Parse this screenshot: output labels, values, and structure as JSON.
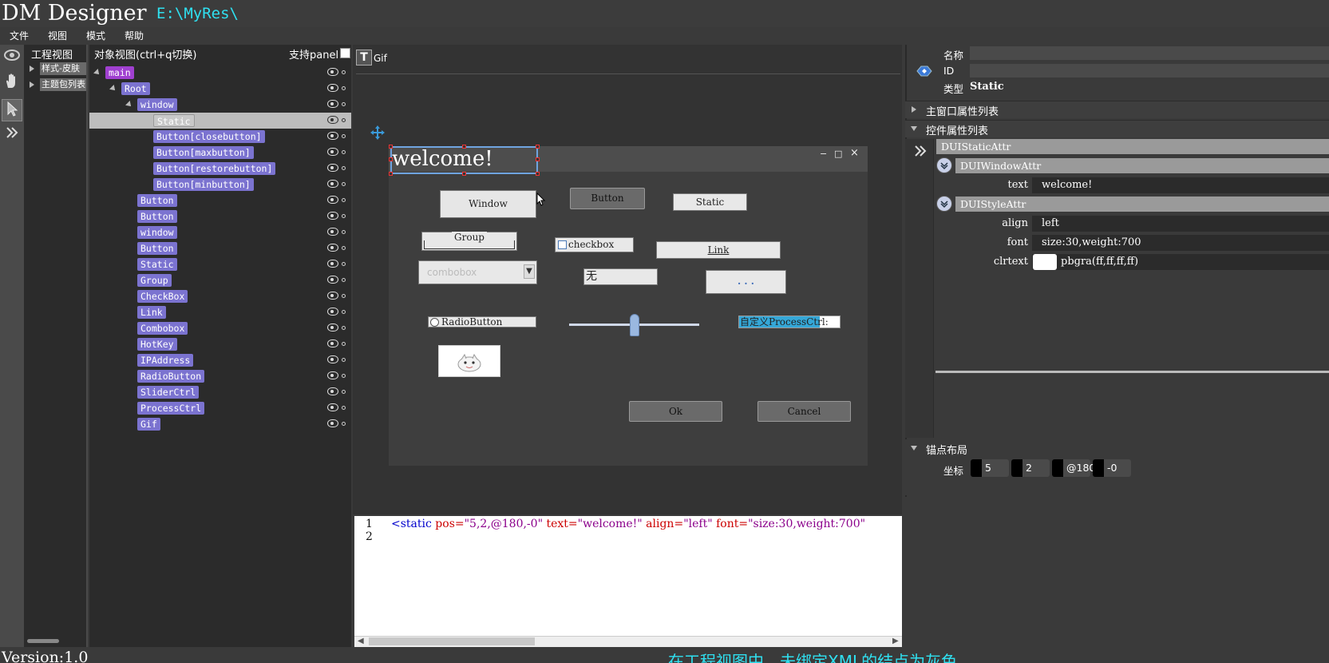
{
  "app": {
    "title": "DM Designer",
    "path": "E:\\MyRes\\"
  },
  "menu": [
    "文件",
    "视图",
    "模式",
    "帮助"
  ],
  "tools": {
    "eye_icon": "eye-icon",
    "hand_icon": "hand-icon",
    "pointer_icon": "pointer-icon",
    "expand_icon": "double-chevron-right-icon"
  },
  "project_view": {
    "header": "工程视图",
    "items": [
      {
        "label": "样式-皮肤"
      },
      {
        "label": "主题包列表"
      }
    ]
  },
  "object_view": {
    "header": "对象视图(ctrl+q切换)",
    "support_label": "支持panel",
    "nodes": [
      {
        "label": "main",
        "expander": true
      },
      {
        "label": "Root",
        "expander": true
      },
      {
        "label": "window",
        "expander": true
      },
      {
        "label": "Static",
        "selected": true
      },
      {
        "label": "Button[closebutton]"
      },
      {
        "label": "Button[maxbutton]"
      },
      {
        "label": "Button[restorebutton]"
      },
      {
        "label": "Button[minbutton]"
      },
      {
        "label": "Button"
      },
      {
        "label": "Button"
      },
      {
        "label": "window"
      },
      {
        "label": "Button"
      },
      {
        "label": "Static"
      },
      {
        "label": "Group"
      },
      {
        "label": "CheckBox"
      },
      {
        "label": "Link"
      },
      {
        "label": "Combobox"
      },
      {
        "label": "HotKey"
      },
      {
        "label": "IPAddress"
      },
      {
        "label": "RadioButton"
      },
      {
        "label": "SliderCtrl"
      },
      {
        "label": "ProcessCtrl"
      },
      {
        "label": "Gif"
      }
    ]
  },
  "canvas": {
    "toolbar_icon_glyph": "T",
    "toolbar_label": "Gif",
    "window": {
      "title": "welcome!",
      "min_glyph": "−",
      "max_glyph": "□",
      "close_glyph": "×"
    },
    "controls": {
      "window_btn": "Window",
      "button_btn": "Button",
      "static_lbl": "Static",
      "group_lbl": "Group",
      "checkbox_lbl": "checkbox",
      "link_lbl": "Link",
      "combobox_val": "combobox",
      "hotkey_val": "无",
      "ip_val": ".  .  .",
      "radio_lbl": "RadioButton",
      "slider_lbl": "SliderCtrl",
      "process_lbl": "自定义ProcessCtrl:",
      "process_fill": 0.8,
      "ok_btn": "Ok",
      "cancel_btn": "Cancel"
    }
  },
  "code": {
    "line_numbers": [
      "1",
      "2"
    ],
    "line1": {
      "open": "<static ",
      "attr1": "pos=",
      "val1": "\"5,2,@180,-0\" ",
      "attr2": "text=",
      "val2": "\"welcome!\" ",
      "attr3": "align=",
      "val3": "\"left\" ",
      "attr4": "font=",
      "val4": "\"size:30,weight:700\""
    }
  },
  "properties": {
    "name_label": "名称",
    "name_value": "",
    "id_label": "ID",
    "id_value": "",
    "type_label": "类型",
    "type_value": "Static",
    "sections": {
      "main_window": "主窗口属性列表",
      "control": "控件属性列表",
      "anchor": "锚点布局"
    },
    "groups": {
      "static_attr": "DUIStaticAttr",
      "window_attr": "DUIWindowAttr",
      "style_attr": "DUIStyleAttr"
    },
    "attrs": {
      "text_k": "text",
      "text_v": "welcome!",
      "align_k": "align",
      "align_v": "left",
      "font_k": "font",
      "font_v": "size:30,weight:700",
      "clrtext_k": "clrtext",
      "clrtext_v": "pbgra(ff,ff,ff,ff)"
    },
    "anchor": {
      "label": "坐标",
      "values": [
        "5",
        "2",
        "@180",
        "-0"
      ]
    }
  },
  "footer": {
    "version": "Version:1.0",
    "hint": "在工程视图中，未绑定XML的结点为灰色"
  },
  "colors": {
    "accent_cyan": "#2fe0f0",
    "node_purple": "#7b73d0",
    "main_node": "#a040d0",
    "selection_blue": "#6fa4e0"
  }
}
